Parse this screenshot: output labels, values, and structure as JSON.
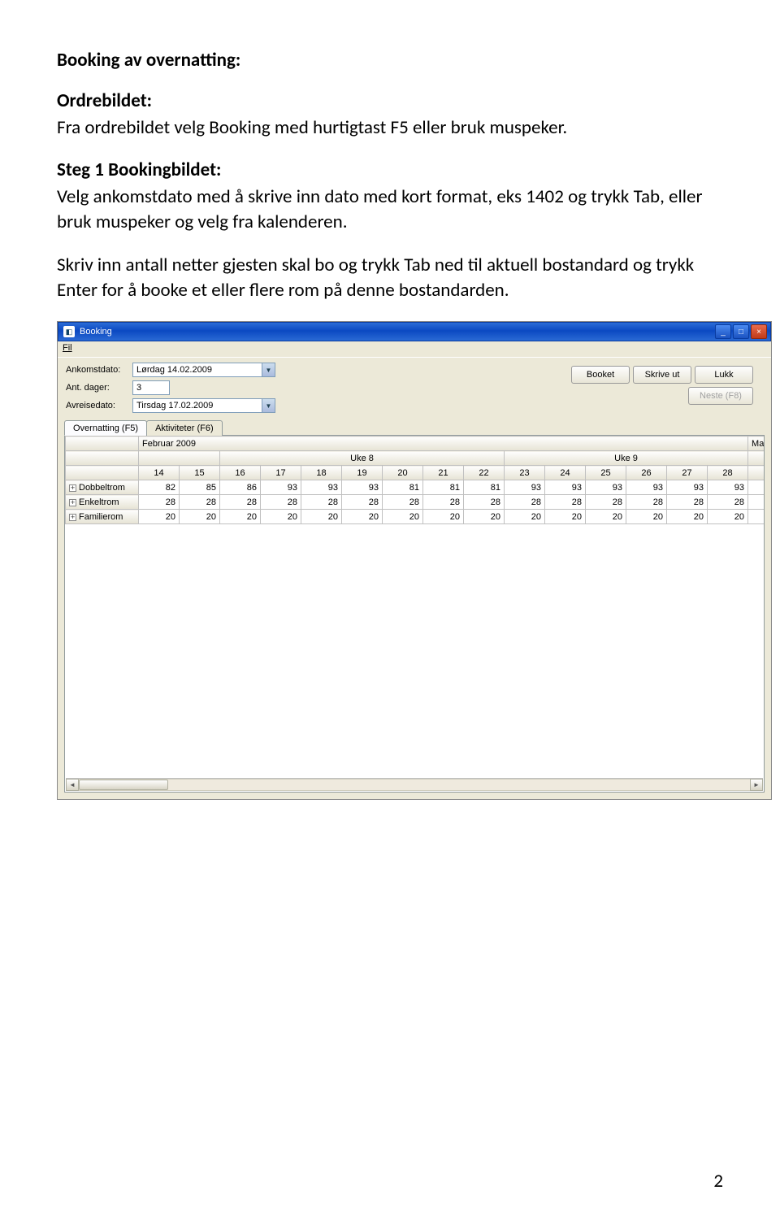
{
  "doc": {
    "heading_main": "Booking av overnatting:",
    "sub1_title": "Ordrebildet:",
    "para1": "Fra ordrebildet velg Booking med hurtigtast F5 eller bruk muspeker.",
    "sub2_title": "Steg 1 Bookingbildet:",
    "para2": "Velg ankomstdato med å skrive inn dato med kort format, eks 1402 og trykk Tab, eller bruk muspeker og velg fra kalenderen.",
    "para3": "Skriv inn antall netter gjesten skal bo og trykk Tab ned til aktuell bostandard og trykk Enter for å booke et eller flere rom på denne bostandarden.",
    "page_num": "2"
  },
  "window": {
    "title": "Booking",
    "menu_fil": "Fil",
    "labels": {
      "ankomst": "Ankomstdato:",
      "antdager": "Ant. dager:",
      "avreise": "Avreisedato:"
    },
    "fields": {
      "ankomst": "Lørdag 14.02.2009",
      "antdager": "3",
      "avreise": "Tirsdag 17.02.2009"
    },
    "buttons": {
      "booket": "Booket",
      "skrivut": "Skrive ut",
      "lukk": "Lukk",
      "neste": "Neste (F8)"
    },
    "tabs": {
      "overnatting": "Overnatting (F5)",
      "aktiviteter": "Aktiviteter (F6)"
    },
    "grid": {
      "month_left": "Februar 2009",
      "month_right": "Mars",
      "week8": "Uke 8",
      "week9": "Uke 9",
      "days": [
        "14",
        "15",
        "16",
        "17",
        "18",
        "19",
        "20",
        "21",
        "22",
        "23",
        "24",
        "25",
        "26",
        "27",
        "28"
      ],
      "rows": [
        {
          "label": "+ Dobbeltrom",
          "vals": [
            "82",
            "85",
            "86",
            "93",
            "93",
            "93",
            "81",
            "81",
            "81",
            "93",
            "93",
            "93",
            "93",
            "93",
            "93"
          ]
        },
        {
          "label": "+ Enkeltrom",
          "vals": [
            "28",
            "28",
            "28",
            "28",
            "28",
            "28",
            "28",
            "28",
            "28",
            "28",
            "28",
            "28",
            "28",
            "28",
            "28"
          ]
        },
        {
          "label": "+ Familierom",
          "vals": [
            "20",
            "20",
            "20",
            "20",
            "20",
            "20",
            "20",
            "20",
            "20",
            "20",
            "20",
            "20",
            "20",
            "20",
            "20"
          ]
        }
      ]
    }
  }
}
